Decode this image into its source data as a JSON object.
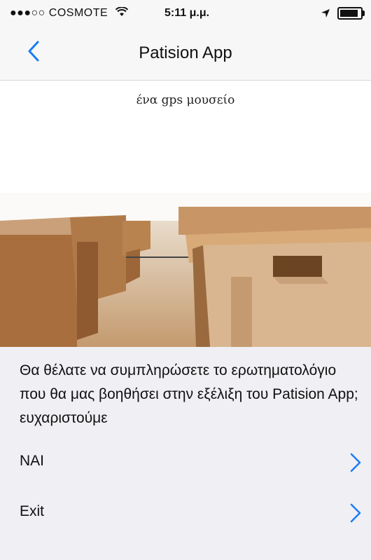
{
  "status_bar": {
    "carrier": "●●●○○ COSMOTE",
    "wifi_icon": "wifi-icon",
    "time": "5:11 μ.μ.",
    "location_icon": "location-arrow-icon",
    "battery_level": 0.9
  },
  "nav": {
    "back_icon": "chevron-left-icon",
    "title": "Patision App",
    "accent": "#1a7cf5"
  },
  "hero": {
    "subtitle": "ένα gps μουσείο"
  },
  "prompt": {
    "text": "Θα θέλατε να συμπληρώσετε το ερωτηματολόγιο που θα μας βοηθήσει στην εξέλιξη του Patision App; ευχαριστούμε"
  },
  "options": [
    {
      "label": "ΝΑΙ"
    },
    {
      "label": "Exit"
    }
  ]
}
